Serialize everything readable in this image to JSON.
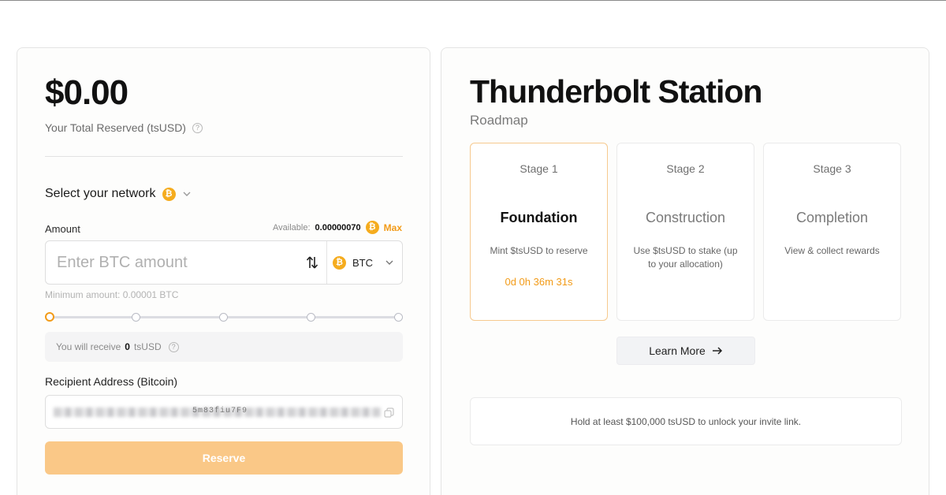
{
  "reserve_panel": {
    "total_value": "$0.00",
    "total_label": "Your Total Reserved (tsUSD)",
    "network_label": "Select your network",
    "network_icon": "bitcoin-icon",
    "amount_label": "Amount",
    "available_label": "Available:",
    "available_value": "0.00000070",
    "max_label": "Max",
    "amount_placeholder": "Enter BTC amount",
    "currency": "BTC",
    "minimum_text": "Minimum amount: 0.00001 BTC",
    "slider_level": 0,
    "receive_prefix": "You will receive",
    "receive_amount": "0",
    "receive_unit": "tsUSD",
    "recipient_label": "Recipient Address (Bitcoin)",
    "address_visible_fragment": "5m83fiu7F9",
    "reserve_button": "Reserve",
    "accent_color": "#f29b18"
  },
  "station_panel": {
    "title": "Thunderbolt Station",
    "subtitle": "Roadmap",
    "stages": [
      {
        "number": "Stage 1",
        "name": "Foundation",
        "description": "Mint $tsUSD to reserve",
        "timer": "0d 0h 36m 31s",
        "active": true
      },
      {
        "number": "Stage 2",
        "name": "Construction",
        "description": "Use $tsUSD to stake (up to your allocation)",
        "timer": "",
        "active": false
      },
      {
        "number": "Stage 3",
        "name": "Completion",
        "description": "View & collect rewards",
        "timer": "",
        "active": false
      }
    ],
    "learn_more": "Learn More",
    "invite_text": "Hold at least $100,000 tsUSD to unlock your invite link."
  }
}
